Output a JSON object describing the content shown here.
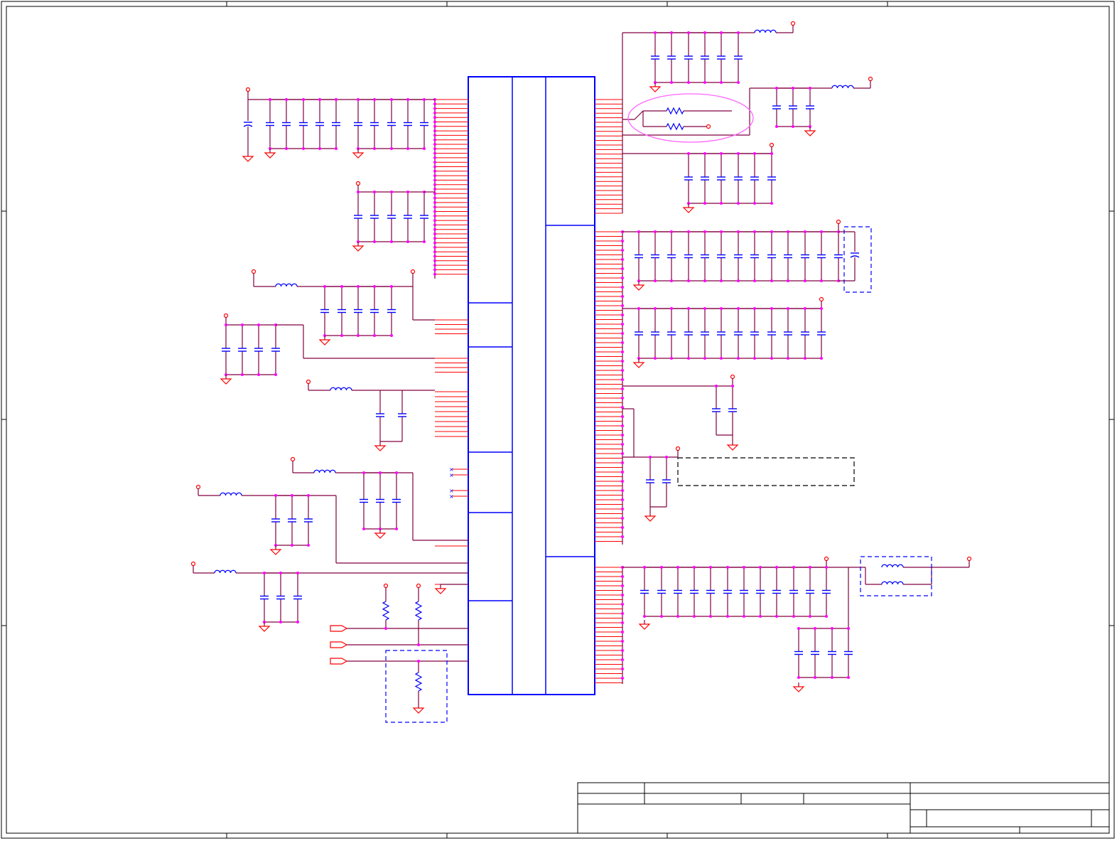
{
  "sheet": {
    "title": "",
    "background": "#ffffff"
  },
  "colors": {
    "wire": "#800040",
    "pin": "#ff0000",
    "component": "#0000ff",
    "junction": "#ff00ff",
    "highlight": "#ff66ff",
    "note_box": "#000000",
    "option_box": "#0000ff",
    "border": "#000000"
  },
  "title_block": {
    "title": "",
    "size": "",
    "document_number": "",
    "revision": "",
    "date": "",
    "sheet_of": ""
  }
}
